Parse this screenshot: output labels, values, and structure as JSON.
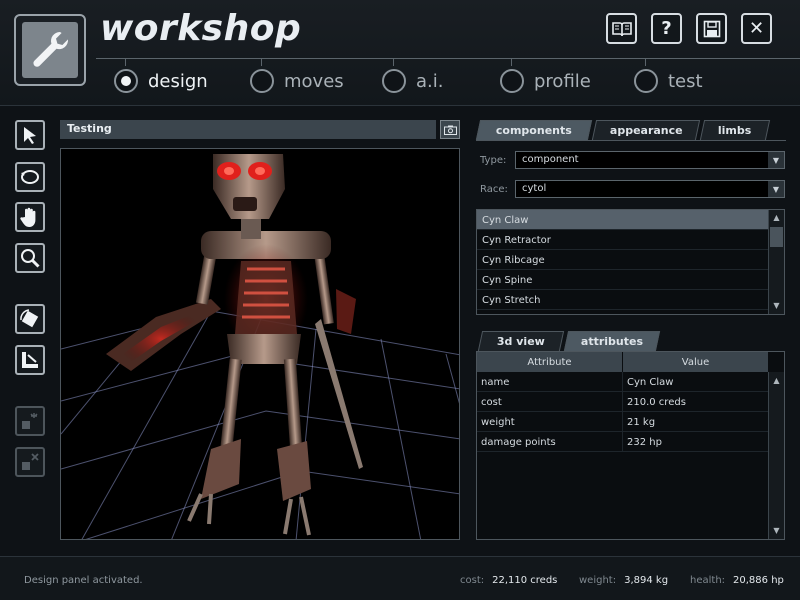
{
  "app": {
    "title": "workshop"
  },
  "header_icons": [
    "book-icon",
    "help-icon",
    "save-icon",
    "close-icon"
  ],
  "help_glyph": "?",
  "close_glyph": "✕",
  "nav": {
    "tabs": [
      {
        "label": "design",
        "active": true
      },
      {
        "label": "moves",
        "active": false
      },
      {
        "label": "a.i.",
        "active": false
      },
      {
        "label": "profile",
        "active": false
      },
      {
        "label": "test",
        "active": false
      }
    ]
  },
  "tools": [
    "pointer-icon",
    "rotate-icon",
    "pan-hand-icon",
    "zoom-icon",
    "rotate-part-icon",
    "ruler-icon",
    "select-disabled-icon",
    "delete-disabled-icon"
  ],
  "viewport": {
    "title": "Testing"
  },
  "right_tabs": [
    {
      "label": "components",
      "active": true
    },
    {
      "label": "appearance",
      "active": false
    },
    {
      "label": "limbs",
      "active": false
    }
  ],
  "filters": {
    "type_label": "Type:",
    "type_value": "component",
    "race_label": "Race:",
    "race_value": "cytol"
  },
  "component_list": {
    "items": [
      "Cyn Claw",
      "Cyn Retractor",
      "Cyn Ribcage",
      "Cyn Spine",
      "Cyn Stretch"
    ],
    "selected_index": 0
  },
  "bottom_tabs": [
    {
      "label": "3d view",
      "active": false
    },
    {
      "label": "attributes",
      "active": true
    }
  ],
  "attributes": {
    "headers": [
      "Attribute",
      "Value"
    ],
    "rows": [
      {
        "name": "name",
        "value": "Cyn Claw"
      },
      {
        "name": "cost",
        "value": "210.0 creds"
      },
      {
        "name": "weight",
        "value": "21 kg"
      },
      {
        "name": "damage points",
        "value": "232 hp"
      }
    ]
  },
  "scroll_up": "▲",
  "scroll_down": "▼",
  "dropdown_arrow": "▼",
  "status": {
    "message": "Design panel activated.",
    "cost_label": "cost:",
    "cost_value": "22,110 creds",
    "weight_label": "weight:",
    "weight_value": "3,894 kg",
    "health_label": "health:",
    "health_value": "20,886 hp"
  },
  "colors": {
    "background": "#0e1216",
    "panel_header": "#3b454d",
    "selection": "#56616b",
    "robot_eye": "#e0201c",
    "grid_line": "#8a94c8"
  }
}
